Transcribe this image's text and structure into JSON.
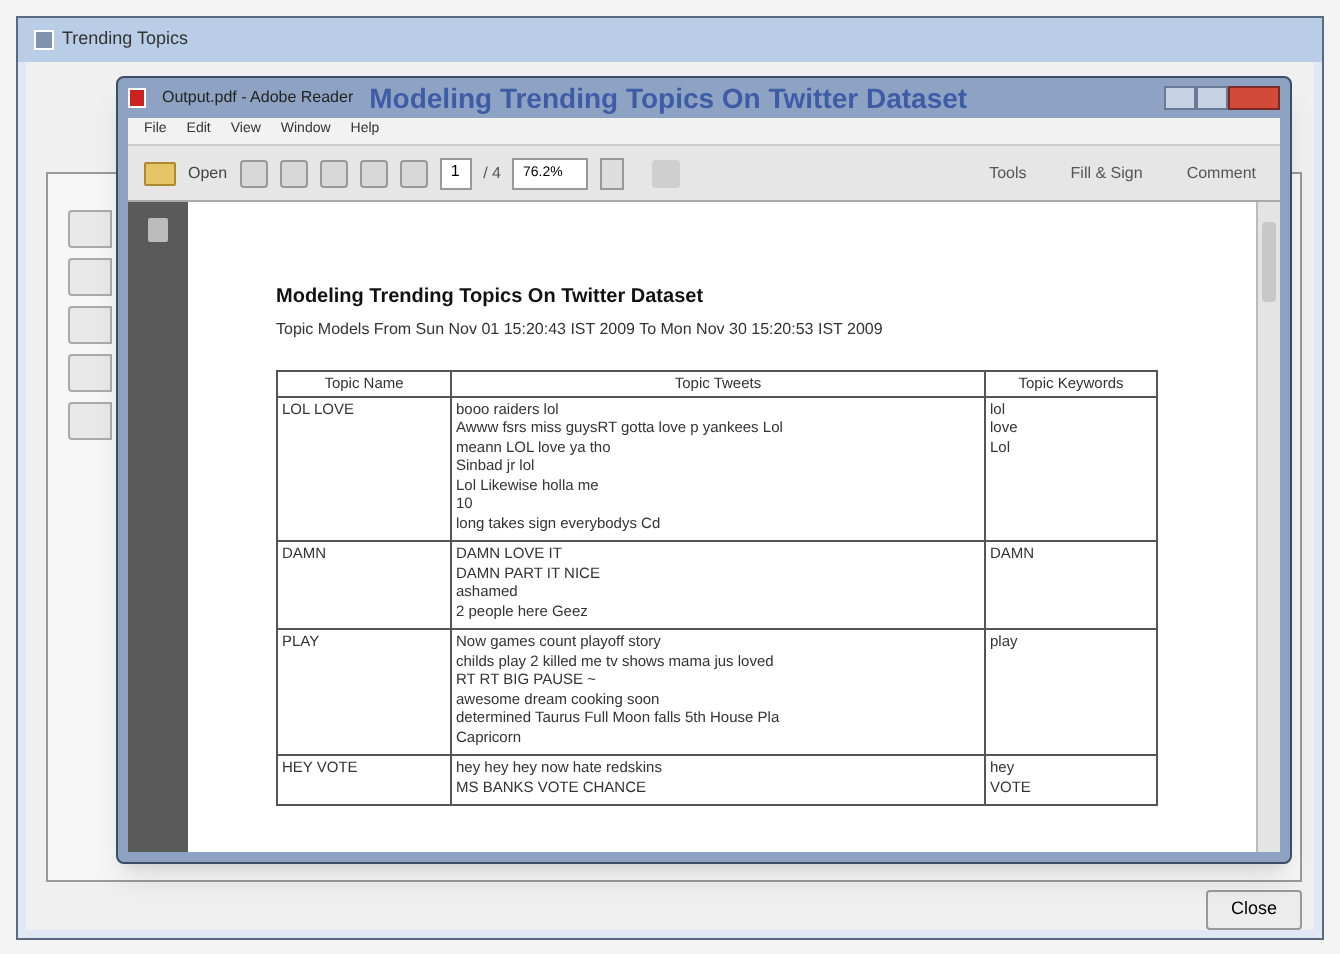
{
  "window": {
    "title": "Trending Topics"
  },
  "close_button": "Close",
  "reader": {
    "title": "Output.pdf - Adobe Reader",
    "title_overlay": "Modeling Trending Topics On Twitter Dataset",
    "menu": [
      "File",
      "Edit",
      "View",
      "Window",
      "Help"
    ],
    "toolbar": {
      "open": "Open",
      "page": "1",
      "page_count": "/ 4",
      "zoom": "76.2%",
      "tools": [
        "Tools",
        "Fill & Sign",
        "Comment"
      ]
    },
    "document": {
      "heading": "Modeling Trending Topics On Twitter Dataset",
      "subtitle": "Topic Models From Sun Nov 01 15:20:43 IST 2009 To Mon Nov 30 15:20:53 IST 2009",
      "columns": [
        "Topic Name",
        "Topic Tweets",
        "Topic Keywords"
      ],
      "rows": [
        {
          "name": "LOL LOVE",
          "tweets": [
            "booo raiders lol",
            "Awww fsrs miss guysRT gotta love p yankees Lol",
            "meann LOL love ya tho",
            "Sinbad jr lol",
            "Lol Likewise holla me",
            "10",
            "long takes sign everybodys Cd"
          ],
          "keywords": [
            "lol",
            "love",
            "Lol"
          ]
        },
        {
          "name": "DAMN",
          "tweets": [
            "DAMN LOVE IT",
            "DAMN PART IT NICE",
            "ashamed",
            "2 people here Geez"
          ],
          "keywords": [
            "DAMN"
          ]
        },
        {
          "name": "PLAY",
          "tweets": [
            "Now games count playoff story",
            "childs play 2 killed me tv shows mama jus loved",
            "RT RT BIG PAUSE ~",
            "awesome dream cooking soon",
            "determined Taurus Full Moon falls 5th House Pla",
            "Capricorn"
          ],
          "keywords": [
            "play"
          ]
        },
        {
          "name": "HEY VOTE",
          "tweets": [
            "hey hey hey now hate redskins",
            "MS BANKS VOTE CHANCE"
          ],
          "keywords": [
            "hey",
            "VOTE"
          ]
        }
      ]
    }
  }
}
